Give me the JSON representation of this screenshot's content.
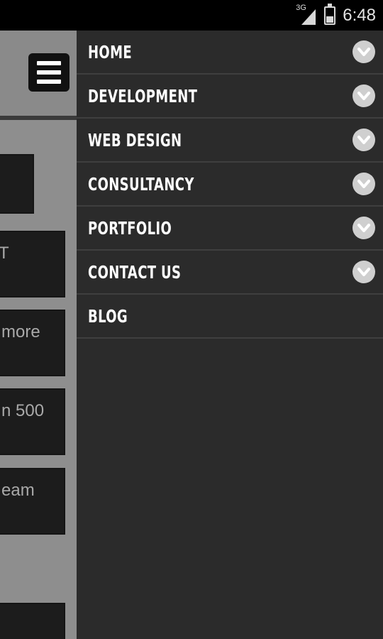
{
  "status_bar": {
    "network_label": "3G",
    "time": "6:48",
    "icons": [
      "signal-icon",
      "battery-charging-icon"
    ]
  },
  "page": {
    "cards": [
      {
        "text": ""
      },
      {
        "text": "T"
      },
      {
        "text": "more"
      },
      {
        "text": "n 500"
      },
      {
        "text": "eam"
      },
      {
        "text": ""
      }
    ]
  },
  "drawer": {
    "items": [
      {
        "label": "HOME",
        "has_submenu": true
      },
      {
        "label": "DEVELOPMENT",
        "has_submenu": true
      },
      {
        "label": "WEB DESIGN",
        "has_submenu": true
      },
      {
        "label": "CONSULTANCY",
        "has_submenu": true
      },
      {
        "label": "PORTFOLIO",
        "has_submenu": true
      },
      {
        "label": "CONTACT US",
        "has_submenu": true
      },
      {
        "label": "BLOG",
        "has_submenu": false
      }
    ]
  },
  "colors": {
    "drawer_bg": "#2b2b2b",
    "divider": "#3f3f3f",
    "chevron_bg": "#cfcfcf"
  }
}
